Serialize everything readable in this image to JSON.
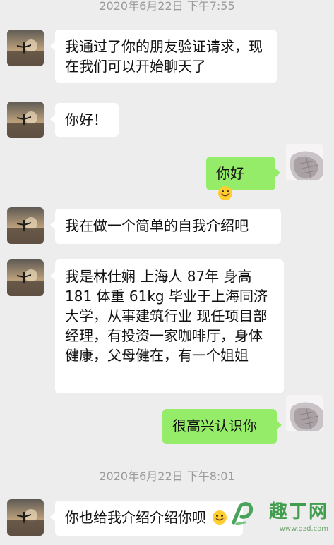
{
  "chat": {
    "timestamps": [
      "2020年6月22日 下午7:55",
      "2020年6月22日 下午8:01"
    ],
    "messages": [
      {
        "direction": "in",
        "text": "我通过了你的朋友验证请求，现在我们可以开始聊天了"
      },
      {
        "direction": "in",
        "text": "你好！"
      },
      {
        "direction": "out",
        "text": "你好",
        "emoji": "smile-emoji"
      },
      {
        "direction": "in",
        "text": "我在做一个简单的自我介绍吧"
      },
      {
        "direction": "in",
        "text": "我是林仕娴 上海人 87年 身高181 体重 61kg 毕业于上海同济大学，从事建筑行业 现任项目部经理，有投资一家咖啡厅，身体健康，父母健在，有一个姐姐"
      },
      {
        "direction": "out",
        "text": "很高兴认识你"
      },
      {
        "direction": "in",
        "text": "你也给我介绍介绍你呗",
        "emoji": "smile-emoji"
      }
    ]
  },
  "watermark": {
    "brand": "趣丁网",
    "url": "www.qzd.com"
  },
  "colors": {
    "background": "#ededed",
    "incoming_bubble": "#ffffff",
    "outgoing_bubble": "#95ec69",
    "timestamp_text": "#9a9a9a"
  }
}
